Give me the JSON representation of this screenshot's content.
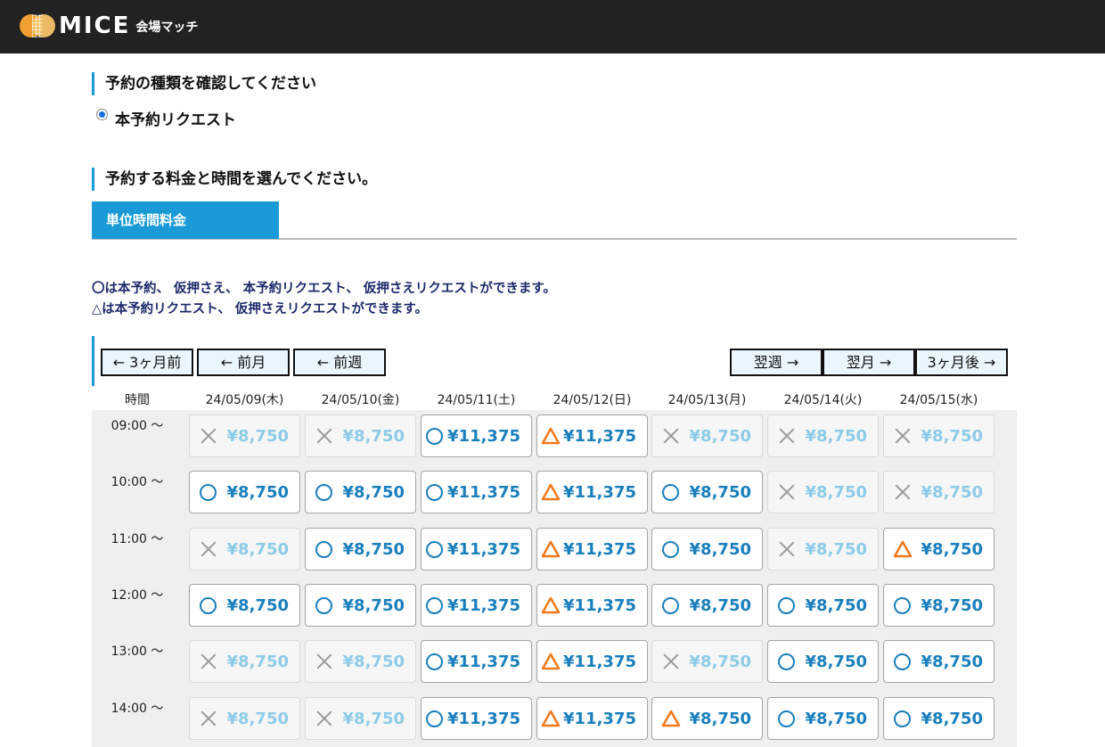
{
  "header": {
    "logo_text": "MICE",
    "logo_sub": "会場マッチ"
  },
  "section1": {
    "title": "予約の種類を確認してください",
    "radio_label": "本予約リクエスト"
  },
  "section2": {
    "title": "予約する料金と時間を選んでください。",
    "tab_label": "単位時間料金"
  },
  "legend": {
    "line1": "〇は本予約、 仮押さえ、 本予約リクエスト、 仮押さえリクエストができます。",
    "line2": "△は本予約リクエスト、 仮押さえリクエストができます。"
  },
  "nav": {
    "prev3": "← 3ヶ月前",
    "prev_month": "← 前月",
    "prev_week": "← 前週",
    "next_week": "翌週 →",
    "next_month": "翌月 →",
    "next3": "3ヶ月後 →"
  },
  "calendar": {
    "time_header": "時間",
    "dates": [
      "24/05/09(木)",
      "24/05/10(金)",
      "24/05/11(土)",
      "24/05/12(日)",
      "24/05/13(月)",
      "24/05/14(火)",
      "24/05/15(水)"
    ],
    "rows": [
      {
        "time": "09:00 ～",
        "slots": [
          [
            "x",
            "¥8,750"
          ],
          [
            "x",
            "¥8,750"
          ],
          [
            "o",
            "¥11,375"
          ],
          [
            "t",
            "¥11,375"
          ],
          [
            "x",
            "¥8,750"
          ],
          [
            "x",
            "¥8,750"
          ],
          [
            "x",
            "¥8,750"
          ]
        ]
      },
      {
        "time": "10:00 ～",
        "slots": [
          [
            "o",
            "¥8,750"
          ],
          [
            "o",
            "¥8,750"
          ],
          [
            "o",
            "¥11,375"
          ],
          [
            "t",
            "¥11,375"
          ],
          [
            "o",
            "¥8,750"
          ],
          [
            "x",
            "¥8,750"
          ],
          [
            "x",
            "¥8,750"
          ]
        ]
      },
      {
        "time": "11:00 ～",
        "slots": [
          [
            "x",
            "¥8,750"
          ],
          [
            "o",
            "¥8,750"
          ],
          [
            "o",
            "¥11,375"
          ],
          [
            "t",
            "¥11,375"
          ],
          [
            "o",
            "¥8,750"
          ],
          [
            "x",
            "¥8,750"
          ],
          [
            "t",
            "¥8,750"
          ]
        ]
      },
      {
        "time": "12:00 ～",
        "slots": [
          [
            "o",
            "¥8,750"
          ],
          [
            "o",
            "¥8,750"
          ],
          [
            "o",
            "¥11,375"
          ],
          [
            "t",
            "¥11,375"
          ],
          [
            "o",
            "¥8,750"
          ],
          [
            "o",
            "¥8,750"
          ],
          [
            "o",
            "¥8,750"
          ]
        ]
      },
      {
        "time": "13:00 ～",
        "slots": [
          [
            "x",
            "¥8,750"
          ],
          [
            "x",
            "¥8,750"
          ],
          [
            "o",
            "¥11,375"
          ],
          [
            "t",
            "¥11,375"
          ],
          [
            "x",
            "¥8,750"
          ],
          [
            "o",
            "¥8,750"
          ],
          [
            "o",
            "¥8,750"
          ]
        ]
      },
      {
        "time": "14:00 ～",
        "slots": [
          [
            "x",
            "¥8,750"
          ],
          [
            "x",
            "¥8,750"
          ],
          [
            "o",
            "¥11,375"
          ],
          [
            "t",
            "¥11,375"
          ],
          [
            "t",
            "¥8,750"
          ],
          [
            "o",
            "¥8,750"
          ],
          [
            "o",
            "¥8,750"
          ]
        ]
      }
    ]
  },
  "colors": {
    "accent": "#1a9bd7",
    "price_available": "#1a7fbd",
    "price_unavailable": "#8ccbe8",
    "triangle": "#f07a1c",
    "header_bg": "#222222",
    "legend_text": "#1d2a6b"
  },
  "icons": {
    "available": "circle-icon",
    "request_only": "triangle-icon",
    "unavailable": "cross-icon"
  }
}
